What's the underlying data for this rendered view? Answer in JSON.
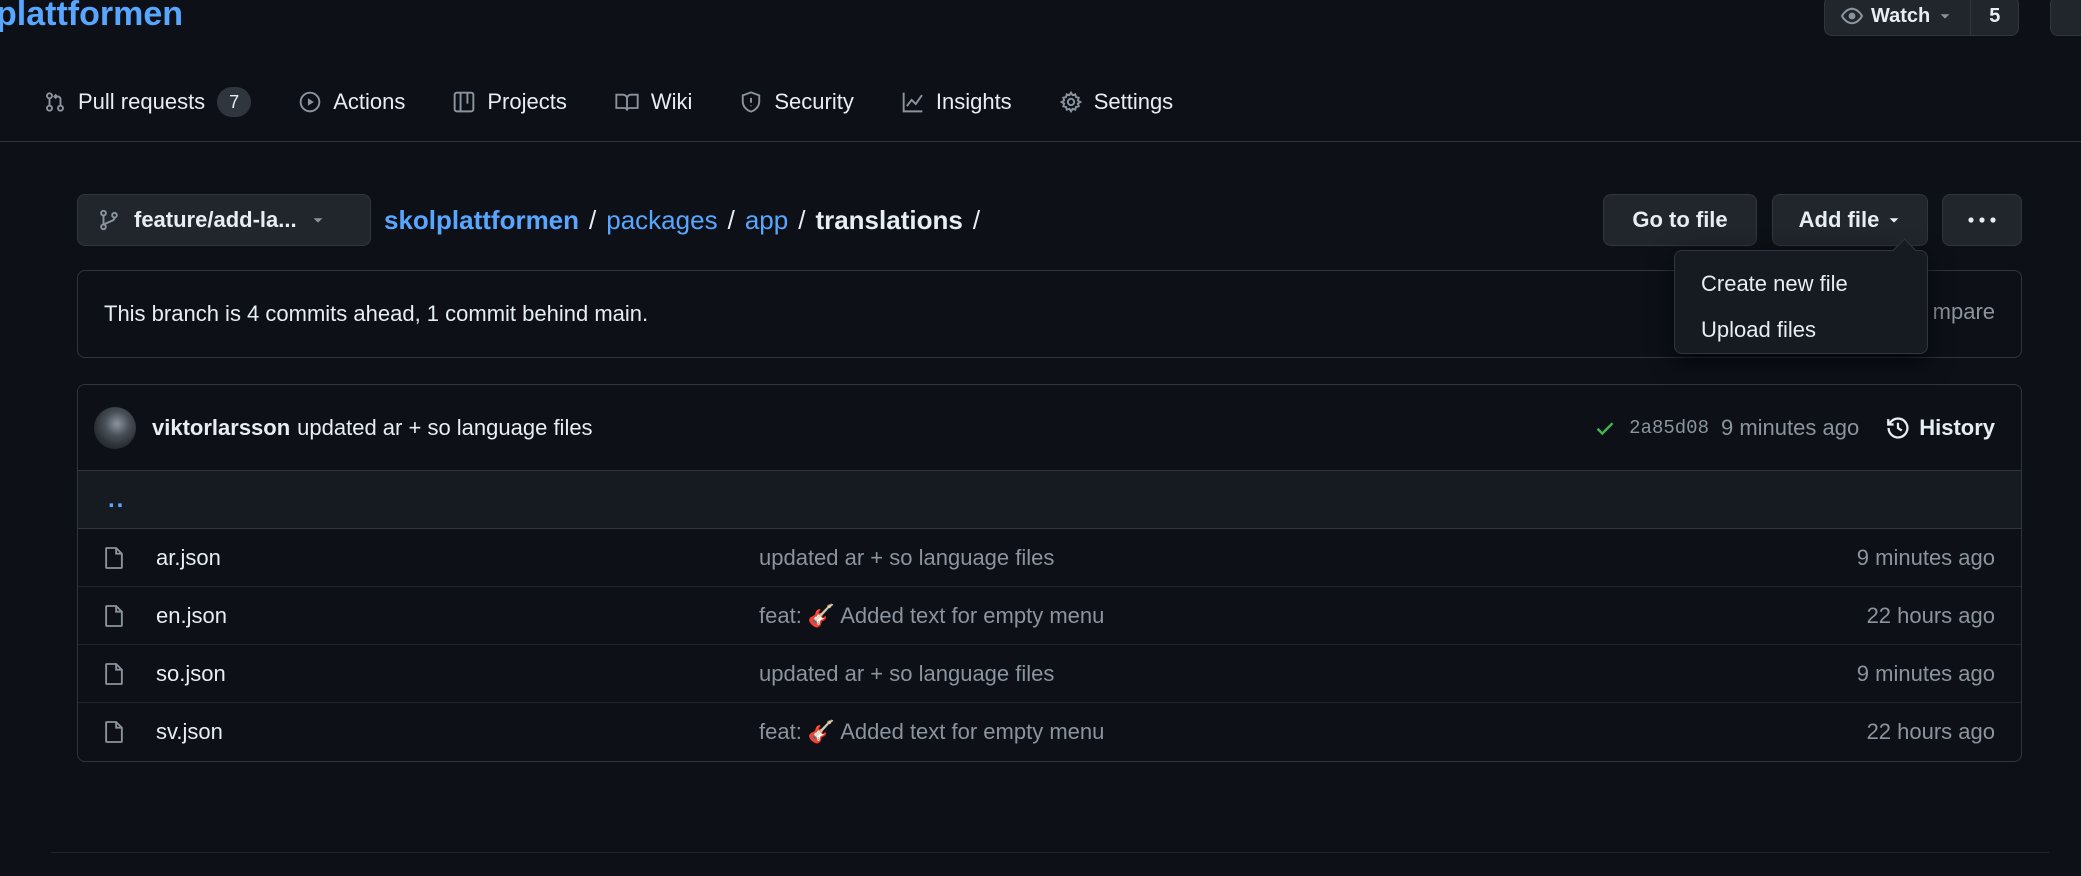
{
  "repo": {
    "title": "plattformen",
    "watch_label": "Watch",
    "watch_count": "5"
  },
  "tabs": [
    {
      "label": "Pull requests",
      "icon": "git-pull-request-icon",
      "counter": "7"
    },
    {
      "label": "Actions",
      "icon": "play-icon"
    },
    {
      "label": "Projects",
      "icon": "table-icon"
    },
    {
      "label": "Wiki",
      "icon": "book-icon"
    },
    {
      "label": "Security",
      "icon": "shield-icon"
    },
    {
      "label": "Insights",
      "icon": "graph-icon"
    },
    {
      "label": "Settings",
      "icon": "gear-icon"
    }
  ],
  "branch": {
    "label": "feature/add-la...",
    "icon": "git-branch-icon"
  },
  "breadcrumb": {
    "root": "skolplattformen",
    "parts": [
      "packages",
      "app"
    ],
    "current": "translations",
    "separator": "/"
  },
  "toolbar": {
    "goto_label": "Go to file",
    "addfile_label": "Add file",
    "more_label": "···"
  },
  "add_file_menu": [
    "Create new file",
    "Upload files"
  ],
  "banner": {
    "text": "This branch is 4 commits ahead, 1 commit behind main.",
    "compare_visible": "mpare"
  },
  "latest_commit": {
    "author": "viktorlarsson",
    "message": "updated ar + so language files",
    "status": "success",
    "sha": "2a85d08",
    "age": "9 minutes ago",
    "history_label": "History"
  },
  "parent_dir_label": "..",
  "files": [
    {
      "name": "ar.json",
      "message": "updated ar + so language files",
      "age": "9 minutes ago"
    },
    {
      "name": "en.json",
      "message": "feat: 🎸 Added text for empty menu",
      "age": "22 hours ago"
    },
    {
      "name": "so.json",
      "message": "updated ar + so language files",
      "age": "9 minutes ago"
    },
    {
      "name": "sv.json",
      "message": "feat: 🎸 Added text for empty menu",
      "age": "22 hours ago"
    }
  ],
  "colors": {
    "background": "#0d1117",
    "link": "#58a6ff",
    "muted": "#8b949e",
    "border": "#30363d",
    "success": "#3fb950"
  }
}
